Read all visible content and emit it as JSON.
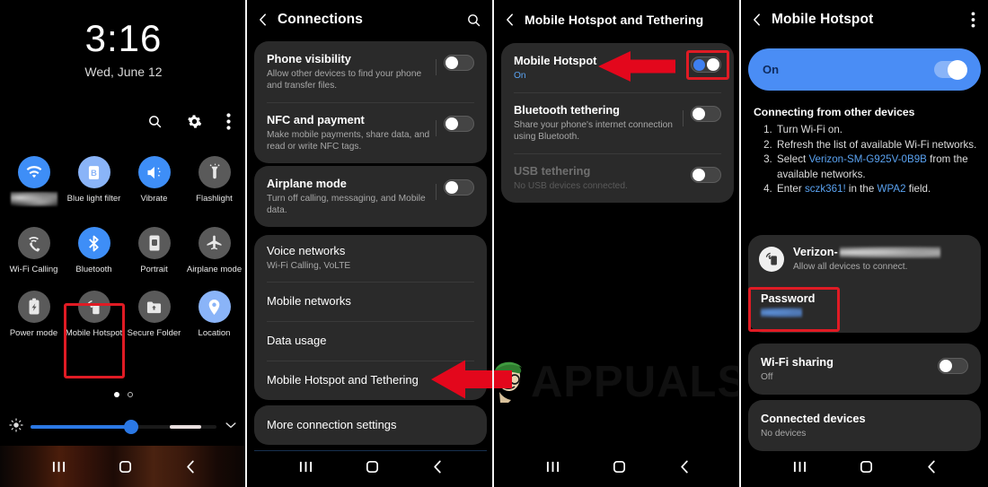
{
  "quick_settings": {
    "clock": "3:16",
    "date": "Wed, June 12",
    "header_icons": [
      "search-icon",
      "gear-icon",
      "overflow-menu-icon"
    ],
    "tiles_row1": [
      {
        "label": "",
        "label_blurred": true,
        "icon": "wifi-icon",
        "state": "on"
      },
      {
        "label": "Blue light filter",
        "icon": "blue-light-filter-icon",
        "state": "on"
      },
      {
        "label": "Vibrate",
        "icon": "vibrate-icon",
        "state": "on"
      },
      {
        "label": "Flashlight",
        "icon": "flashlight-icon",
        "state": "off"
      }
    ],
    "tiles_row2": [
      {
        "label": "Wi-Fi Calling",
        "icon": "wifi-calling-icon",
        "state": "off"
      },
      {
        "label": "Bluetooth",
        "icon": "bluetooth-icon",
        "state": "on"
      },
      {
        "label": "Portrait",
        "icon": "portrait-rotation-icon",
        "state": "off"
      },
      {
        "label": "Airplane mode",
        "icon": "airplane-icon",
        "state": "off"
      }
    ],
    "tiles_row3": [
      {
        "label": "Power mode",
        "icon": "power-mode-icon",
        "state": "off"
      },
      {
        "label": "Mobile Hotspot",
        "icon": "mobile-hotspot-icon",
        "state": "off",
        "highlighted": true
      },
      {
        "label": "Secure Folder",
        "icon": "secure-folder-icon",
        "state": "off"
      },
      {
        "label": "Location",
        "icon": "location-pin-icon",
        "state": "on"
      }
    ],
    "page_dots": 2,
    "active_dot": 1,
    "brightness": {
      "icon": "brightness-icon",
      "value_percent": 54,
      "expand_icon": "chevron-down-icon"
    }
  },
  "connections": {
    "title": "Connections",
    "back_icon": "back-arrow-icon",
    "search_icon": "search-icon",
    "group1": [
      {
        "title": "Phone visibility",
        "sub": "Allow other devices to find your phone and transfer files.",
        "toggle": "off"
      },
      {
        "title": "NFC and payment",
        "sub": "Make mobile payments, share data, and read or write NFC tags.",
        "toggle": "off"
      }
    ],
    "group2": [
      {
        "title": "Airplane mode",
        "sub": "Turn off calling, messaging, and Mobile data.",
        "toggle": "off"
      }
    ],
    "group3": [
      {
        "title": "Voice networks",
        "sub": "Wi-Fi Calling, VoLTE"
      },
      {
        "title": "Mobile networks",
        "sub": ""
      },
      {
        "title": "Data usage",
        "sub": ""
      },
      {
        "title": "Mobile Hotspot and Tethering",
        "sub": "",
        "arrow_pointer": true
      }
    ],
    "group4": [
      {
        "title": "More connection settings",
        "sub": ""
      }
    ]
  },
  "tethering": {
    "title": "Mobile Hotspot and Tethering",
    "back_icon": "back-arrow-icon",
    "rows": [
      {
        "title": "Mobile Hotspot",
        "sub": "On",
        "toggle": "on",
        "highlighted": true,
        "arrow_pointer": true
      },
      {
        "title": "Bluetooth tethering",
        "sub": "Share your phone's internet connection using Bluetooth.",
        "toggle": "off"
      },
      {
        "title": "USB tethering",
        "sub": "No USB devices connected.",
        "toggle": "off",
        "disabled": true
      }
    ]
  },
  "hotspot": {
    "title": "Mobile Hotspot",
    "back_icon": "back-arrow-icon",
    "menu_icon": "overflow-menu-icon",
    "master_switch": {
      "label": "On",
      "state": "on"
    },
    "instructions_heading": "Connecting from other devices",
    "steps": [
      {
        "n": "1.",
        "parts": [
          {
            "t": "Turn Wi-Fi on.",
            "c": "plain"
          }
        ]
      },
      {
        "n": "2.",
        "parts": [
          {
            "t": "Refresh the list of available Wi-Fi networks.",
            "c": "plain"
          }
        ]
      },
      {
        "n": "3.",
        "parts": [
          {
            "t": "Select ",
            "c": "plain"
          },
          {
            "t": "Verizon-SM-G925V-0B9B",
            "c": "blue"
          },
          {
            "t": " from the available networks.",
            "c": "plain"
          }
        ]
      },
      {
        "n": "4.",
        "parts": [
          {
            "t": "Enter ",
            "c": "plain"
          },
          {
            "t": "sczk361!",
            "c": "blue"
          },
          {
            "t": " in the ",
            "c": "plain"
          },
          {
            "t": "WPA2",
            "c": "blue"
          },
          {
            "t": " field.",
            "c": "plain"
          }
        ]
      }
    ],
    "network": {
      "icon": "mobile-hotspot-icon",
      "name_prefix": "Verizon-",
      "name_blurred": true,
      "sub": "Allow all devices to connect."
    },
    "password": {
      "title": "Password",
      "value_blurred": true,
      "highlighted": true
    },
    "wifi_sharing": {
      "title": "Wi-Fi sharing",
      "sub": "Off",
      "toggle": "off"
    },
    "connected_devices": {
      "title": "Connected devices",
      "sub": "No devices"
    }
  },
  "navbar": {
    "recents_icon": "recents-icon",
    "home_icon": "home-icon",
    "back_icon": "back-icon"
  },
  "watermark": {
    "text": "APPUALS",
    "mascot_icon": "appuals-mascot-icon"
  },
  "colors": {
    "accent_blue": "#3e8ef7",
    "highlight_red": "#e01b24",
    "card_bg": "#2a2a2a",
    "link_blue": "#5aa2f0"
  }
}
